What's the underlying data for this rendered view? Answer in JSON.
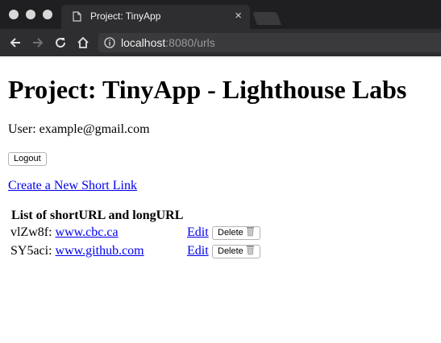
{
  "browser": {
    "tab_title": "Project: TinyApp",
    "tab_close": "×",
    "url_host": "localhost",
    "url_rest": ":8080/urls"
  },
  "page": {
    "heading": "Project: TinyApp - Lighthouse Labs",
    "user_line": "User: example@gmail.com",
    "logout_label": "Logout",
    "create_link": "Create a New Short Link",
    "table_title": "List of shortURL and longURL",
    "edit_label": "Edit",
    "delete_label": "Delete",
    "rows": [
      {
        "short": "vlZw8f:",
        "long": "www.cbc.ca"
      },
      {
        "short": "SY5aci:",
        "long": "www.github.com"
      }
    ]
  }
}
